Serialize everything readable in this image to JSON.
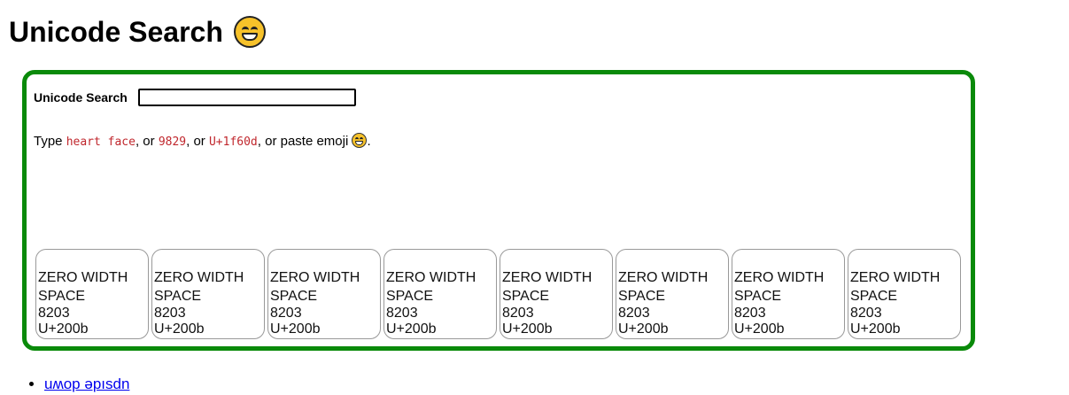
{
  "page": {
    "title": "Unicode Search",
    "title_emoji": "grinning-face-icon"
  },
  "search": {
    "label": "Unicode Search",
    "value": "",
    "placeholder": ""
  },
  "hint": {
    "prefix": "Type ",
    "example1": "heart face",
    "sep1": ", or ",
    "example2": "9829",
    "sep2": ", or ",
    "example3": "U+1f60d",
    "sep3": ", or paste emoji ",
    "suffix": "."
  },
  "results": [
    {
      "name": "ZERO WIDTH SPACE",
      "decimal": "8203",
      "codepoint": "U+200b"
    },
    {
      "name": "ZERO WIDTH SPACE",
      "decimal": "8203",
      "codepoint": "U+200b"
    },
    {
      "name": "ZERO WIDTH SPACE",
      "decimal": "8203",
      "codepoint": "U+200b"
    },
    {
      "name": "ZERO WIDTH SPACE",
      "decimal": "8203",
      "codepoint": "U+200b"
    },
    {
      "name": "ZERO WIDTH SPACE",
      "decimal": "8203",
      "codepoint": "U+200b"
    },
    {
      "name": "ZERO WIDTH SPACE",
      "decimal": "8203",
      "codepoint": "U+200b"
    },
    {
      "name": "ZERO WIDTH SPACE",
      "decimal": "8203",
      "codepoint": "U+200b"
    },
    {
      "name": "ZERO WIDTH SPACE",
      "decimal": "8203",
      "codepoint": "U+200b"
    }
  ],
  "links": [
    {
      "label": "uʍop ǝpısdn"
    }
  ],
  "colors": {
    "panel_border": "#0a8a0a",
    "code_text": "#c0272d",
    "link": "#0000ee"
  }
}
